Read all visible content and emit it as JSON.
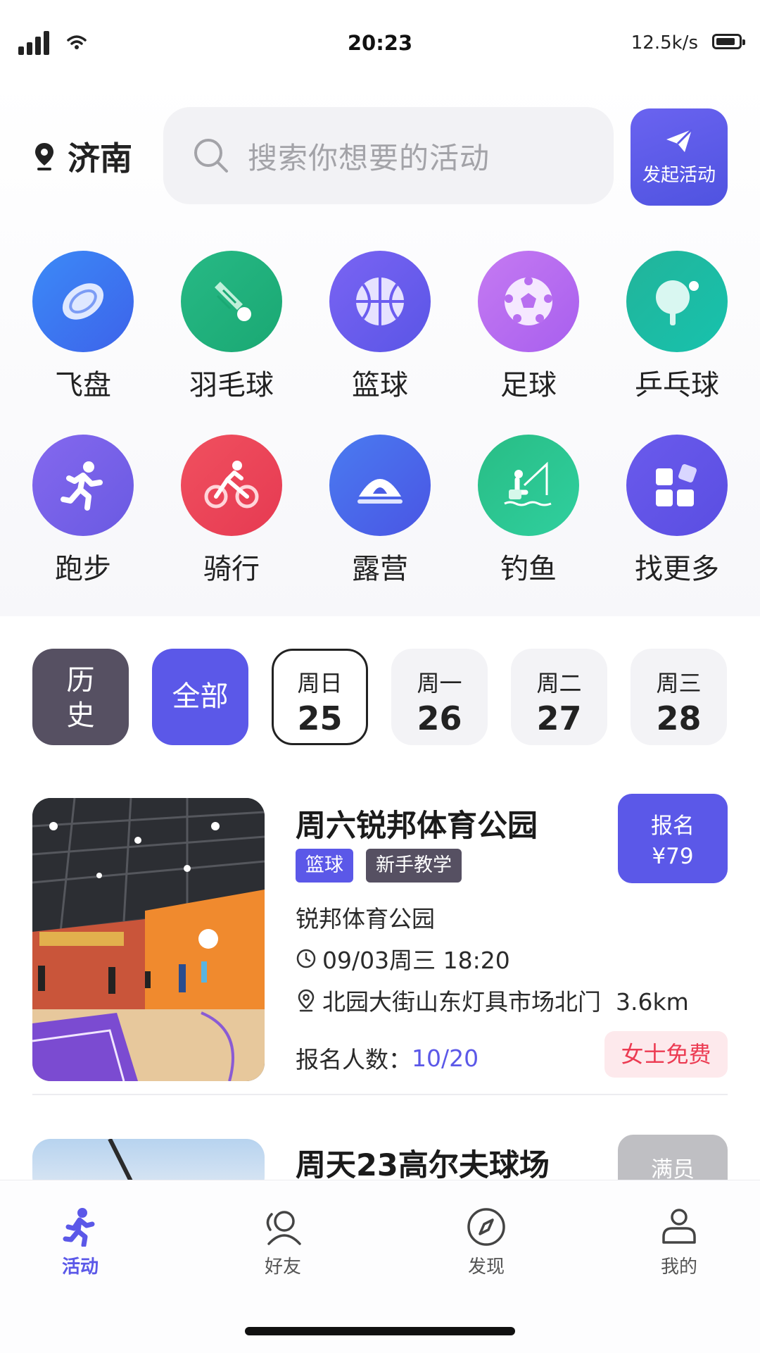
{
  "status_bar": {
    "time": "20:23",
    "network_speed": "12.5k/s"
  },
  "header": {
    "city": "济南",
    "search_placeholder": "搜索你想要的活动",
    "launch_label": "发起活动"
  },
  "categories": [
    {
      "label": "飞盘",
      "icon": "frisbee-icon",
      "color": "#3f7bf0"
    },
    {
      "label": "羽毛球",
      "icon": "badminton-icon",
      "color": "#22b07c"
    },
    {
      "label": "篮球",
      "icon": "basketball-icon",
      "color": "#6b5cf0"
    },
    {
      "label": "足球",
      "icon": "soccer-icon",
      "color": "#b86ef0"
    },
    {
      "label": "乒乓球",
      "icon": "pingpong-icon",
      "color": "#1fb39c"
    },
    {
      "label": "跑步",
      "icon": "running-icon",
      "color": "#7b63e8"
    },
    {
      "label": "骑行",
      "icon": "cycling-icon",
      "color": "#ee4a5c"
    },
    {
      "label": "露营",
      "icon": "tent-icon",
      "color": "#4a67ea"
    },
    {
      "label": "钓鱼",
      "icon": "fishing-icon",
      "color": "#26b987"
    },
    {
      "label": "找更多",
      "icon": "more-grid-icon",
      "color": "#6354ea"
    }
  ],
  "date_filter": {
    "history_top": "历",
    "history_bottom": "史",
    "all": "全部",
    "days": [
      {
        "weekday": "周日",
        "date": "25",
        "selected": true
      },
      {
        "weekday": "周一",
        "date": "26"
      },
      {
        "weekday": "周二",
        "date": "27"
      },
      {
        "weekday": "周三",
        "date": "28"
      }
    ]
  },
  "activities": [
    {
      "title": "周六锐邦体育公园",
      "tags": [
        "篮球",
        "新手教学"
      ],
      "venue": "锐邦体育公园",
      "time": "09/03周三 18:20",
      "address": "北园大街山东灯具市场北门  3.6km",
      "signup_label": "报名",
      "price": "¥79",
      "participants_label": "报名人数：",
      "participants": "10/20",
      "badge": "女士免费"
    },
    {
      "title": "周天23高尔夫球场",
      "status": "满员"
    }
  ],
  "tab_bar": [
    {
      "label": "活动",
      "active": true
    },
    {
      "label": "好友"
    },
    {
      "label": "发现"
    },
    {
      "label": "我的"
    }
  ]
}
